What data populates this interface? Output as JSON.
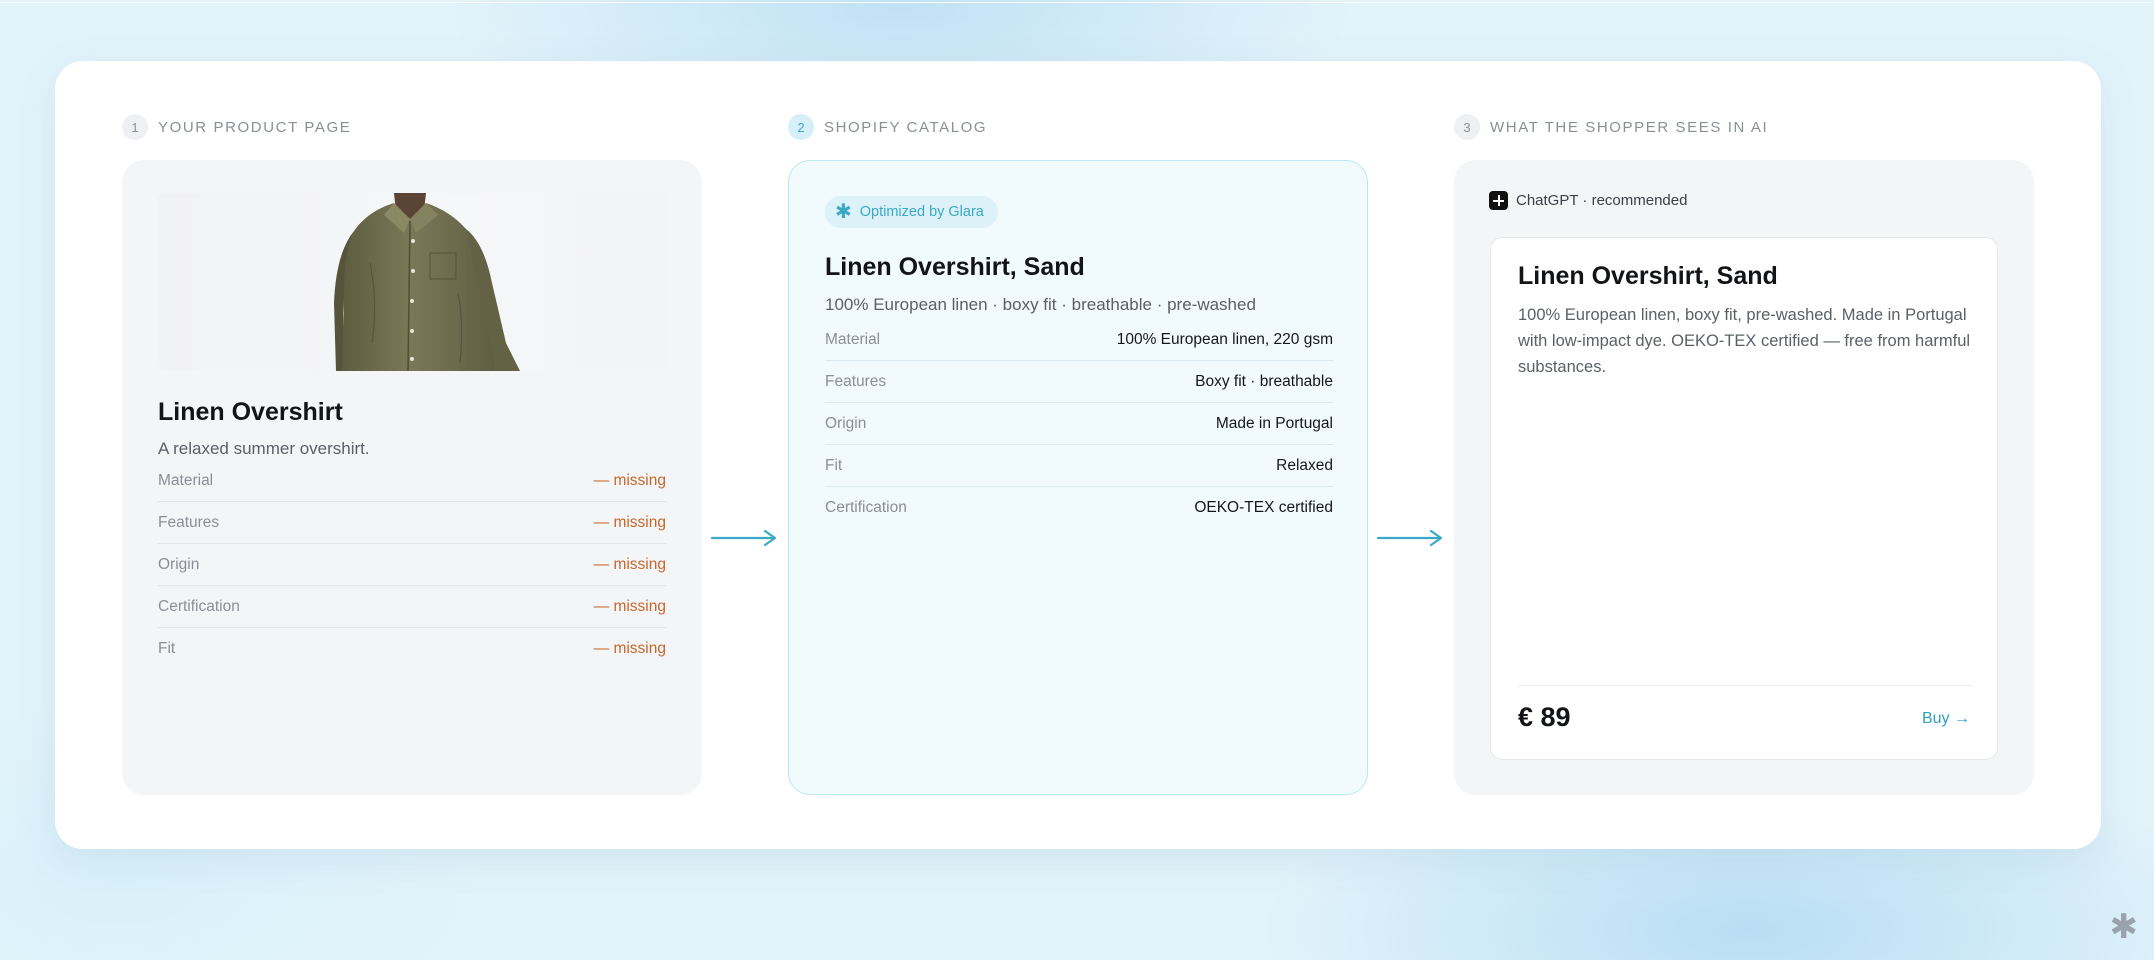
{
  "steps": [
    {
      "num": "1",
      "label": "YOUR PRODUCT PAGE"
    },
    {
      "num": "2",
      "label": "SHOPIFY CATALOG"
    },
    {
      "num": "3",
      "label": "WHAT THE SHOPPER SEES IN AI"
    }
  ],
  "product_page": {
    "title": "Linen Overshirt",
    "subtitle": "A relaxed summer overshirt.",
    "image_icon": "shirt-product-image",
    "attributes": [
      {
        "label": "Material",
        "value": "— missing"
      },
      {
        "label": "Features",
        "value": "— missing"
      },
      {
        "label": "Origin",
        "value": "— missing"
      },
      {
        "label": "Certification",
        "value": "— missing"
      },
      {
        "label": "Fit",
        "value": "— missing"
      }
    ]
  },
  "catalog": {
    "badge": "Optimized by Glara",
    "badge_icon": "asterisk-icon",
    "title": "Linen Overshirt, Sand",
    "subtitle": "100% European linen · boxy fit · breathable · pre-washed",
    "attributes": [
      {
        "label": "Material",
        "value": "100% European linen, 220 gsm"
      },
      {
        "label": "Features",
        "value": "Boxy fit · breathable"
      },
      {
        "label": "Origin",
        "value": "Made in Portugal"
      },
      {
        "label": "Fit",
        "value": "Relaxed"
      },
      {
        "label": "Certification",
        "value": "OEKO-TEX certified"
      }
    ]
  },
  "ai_view": {
    "source": "ChatGPT · recommended",
    "source_icon": "chatgpt-icon",
    "title": "Linen Overshirt, Sand",
    "description": "100% European linen, boxy fit, pre-washed. Made in Portugal with low-impact dye. OEKO-TEX certified — free from harmful substances.",
    "price": "€ 89",
    "buy_label": "Buy →"
  },
  "colors": {
    "accent": "#3aa9c6",
    "missing": "#c8662f",
    "shirt": "#72704f"
  }
}
